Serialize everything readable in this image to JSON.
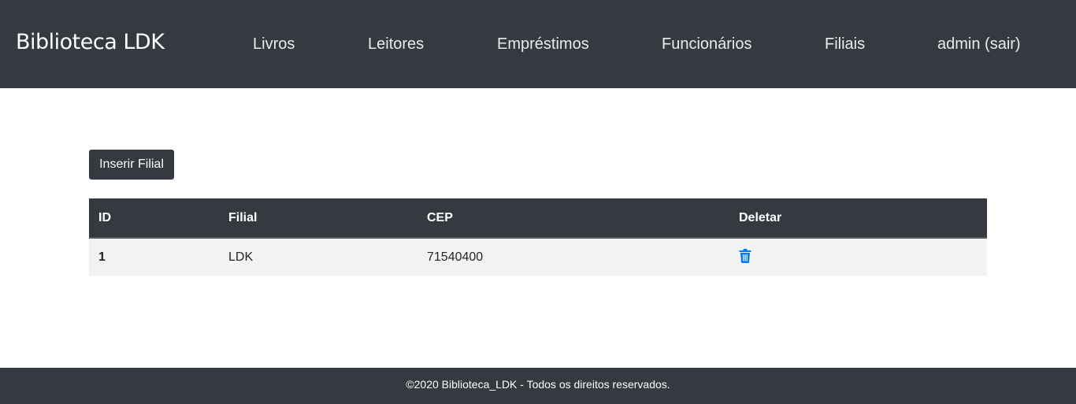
{
  "navbar": {
    "brand": "Biblioteca LDK",
    "links": {
      "livros": "Livros",
      "leitores": "Leitores",
      "emprestimos": "Empréstimos",
      "funcionarios": "Funcionários",
      "filiais": "Filiais",
      "admin": "admin (sair)"
    }
  },
  "main": {
    "insert_button": "Inserir Filial",
    "table": {
      "headers": {
        "id": "ID",
        "filial": "Filial",
        "cep": "CEP",
        "deletar": "Deletar"
      },
      "rows": [
        {
          "id": "1",
          "filial": "LDK",
          "cep": "71540400",
          "delete_icon": "trash-icon"
        }
      ]
    }
  },
  "footer": {
    "text": "©2020 Biblioteca_LDK - Todos os direitos reservados."
  },
  "colors": {
    "navbar_bg": "#343a40",
    "row_bg": "#f2f2f2",
    "accent_blue": "#007bff"
  }
}
